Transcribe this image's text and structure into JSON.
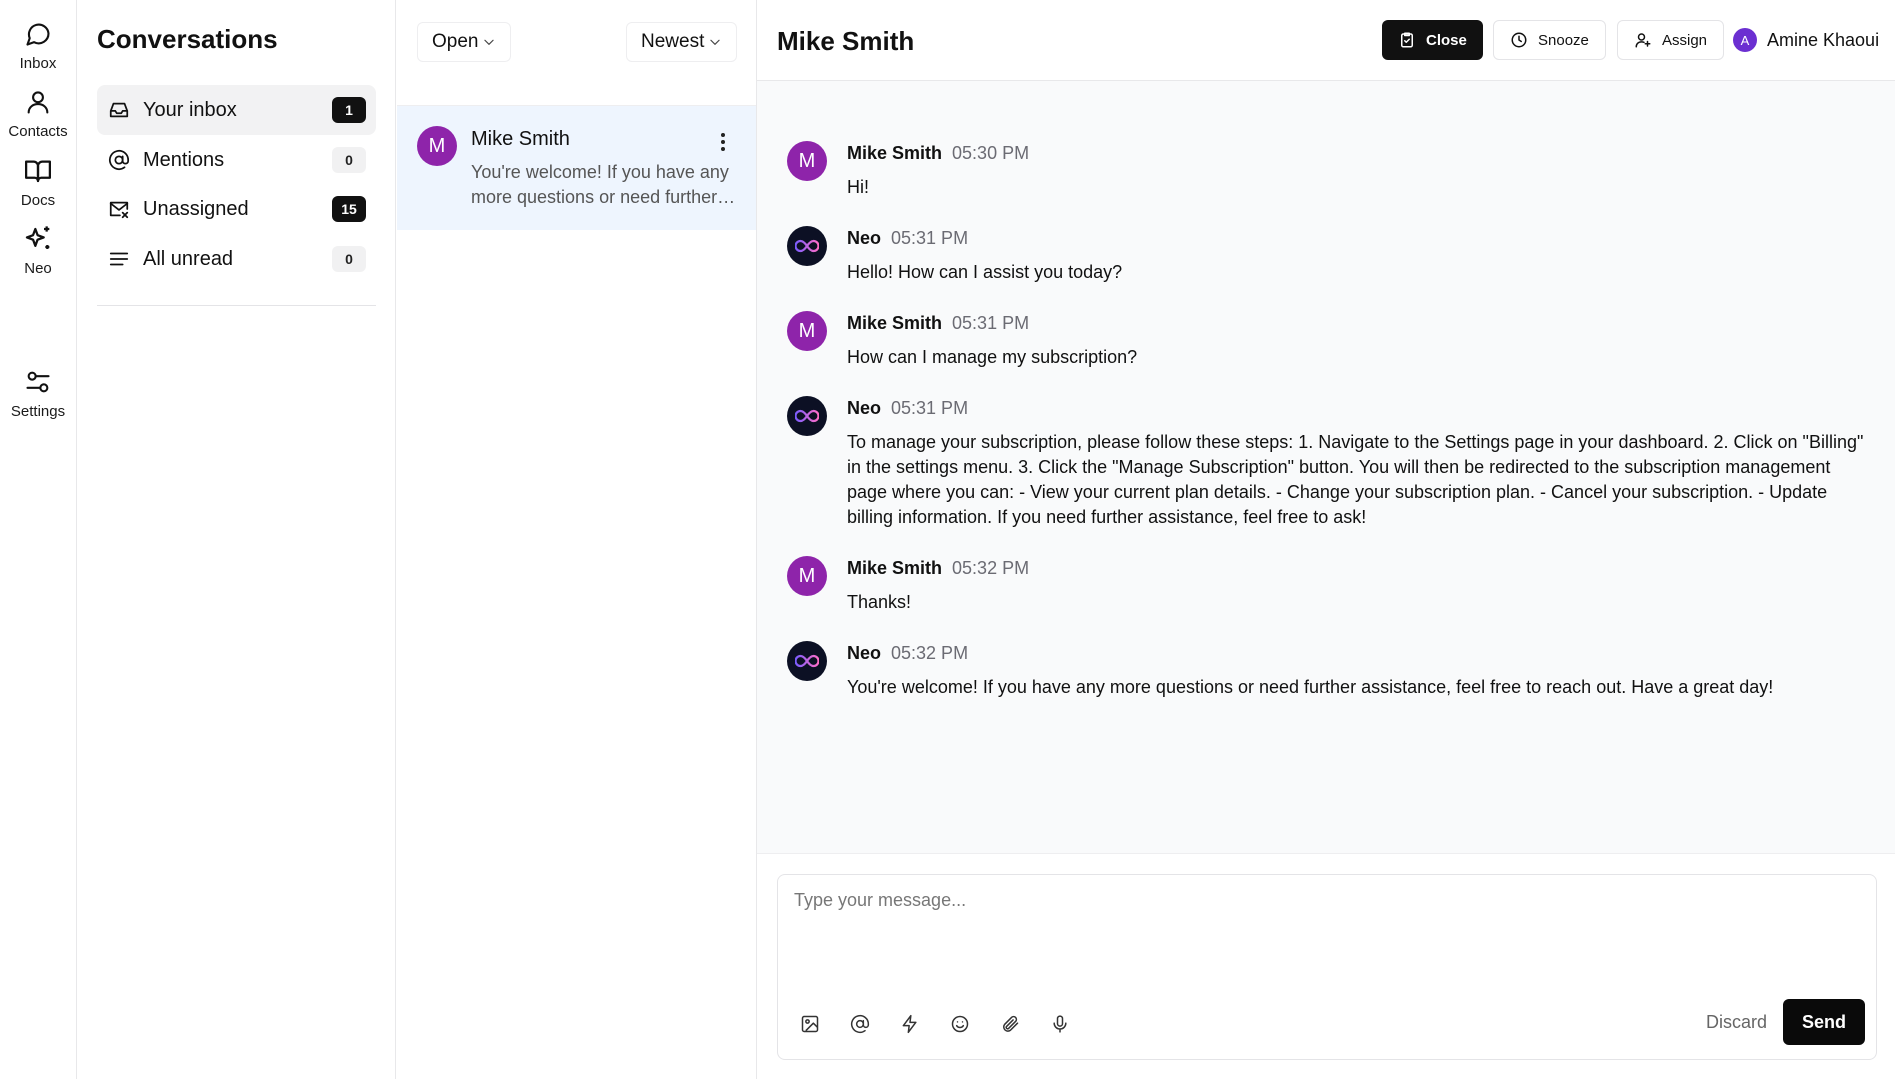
{
  "rail": {
    "items": [
      {
        "label": "Inbox",
        "icon": "chat-bubble-icon"
      },
      {
        "label": "Contacts",
        "icon": "person-icon"
      },
      {
        "label": "Docs",
        "icon": "book-icon"
      },
      {
        "label": "Neo",
        "icon": "sparkles-icon"
      },
      {
        "label": "Settings",
        "icon": "sliders-icon"
      }
    ]
  },
  "conversations": {
    "title": "Conversations",
    "nav": [
      {
        "label": "Your inbox",
        "count": "1",
        "icon": "inbox-tray-icon",
        "active": true
      },
      {
        "label": "Mentions",
        "count": "0",
        "icon": "at-sign-icon",
        "active": false
      },
      {
        "label": "Unassigned",
        "count": "15",
        "icon": "mail-x-icon",
        "active": false
      },
      {
        "label": "All unread",
        "count": "0",
        "icon": "lines-icon",
        "active": false
      }
    ]
  },
  "list": {
    "status_filter": "Open",
    "sort_filter": "Newest",
    "items": [
      {
        "initial": "M",
        "name": "Mike Smith",
        "preview": "You're welcome! If you have any more questions or need further assistance, feel free to reach out. Have a great day!"
      }
    ]
  },
  "chat": {
    "title": "Mike Smith",
    "actions": {
      "close": "Close",
      "snooze": "Snooze",
      "assign": "Assign"
    },
    "user": {
      "initial": "A",
      "name": "Amine Khaoui"
    },
    "messages": [
      {
        "author": "Mike Smith",
        "time": "05:30 PM",
        "kind": "user",
        "initial": "M",
        "text": "Hi!"
      },
      {
        "author": "Neo",
        "time": "05:31 PM",
        "kind": "bot",
        "text": "Hello! How can I assist you today?"
      },
      {
        "author": "Mike Smith",
        "time": "05:31 PM",
        "kind": "user",
        "initial": "M",
        "text": "How can I manage my subscription?"
      },
      {
        "author": "Neo",
        "time": "05:31 PM",
        "kind": "bot",
        "text": "To manage your subscription, please follow these steps: 1. Navigate to the Settings page in your dashboard. 2. Click on \"Billing\" in the settings menu. 3. Click the \"Manage Subscription\" button. You will then be redirected to the subscription management page where you can: - View your current plan details. - Change your subscription plan. - Cancel your subscription. - Update billing information. If you need further assistance, feel free to ask!"
      },
      {
        "author": "Mike Smith",
        "time": "05:32 PM",
        "kind": "user",
        "initial": "M",
        "text": "Thanks!"
      },
      {
        "author": "Neo",
        "time": "05:32 PM",
        "kind": "bot",
        "text": "You're welcome! If you have any more questions or need further assistance, feel free to reach out. Have a great day!"
      }
    ],
    "composer": {
      "placeholder": "Type your message...",
      "value": "",
      "tools": [
        "image-icon",
        "at-sign-icon",
        "lightning-icon",
        "smiley-icon",
        "paperclip-icon",
        "microphone-icon"
      ],
      "discard": "Discard",
      "send": "Send"
    }
  },
  "colors": {
    "avatar_purple": "#8e24aa",
    "user_avatar": "#6b2fd1",
    "selected_row": "#eef5fe",
    "primary_button": "#111111",
    "chat_background": "#f9fafb"
  }
}
